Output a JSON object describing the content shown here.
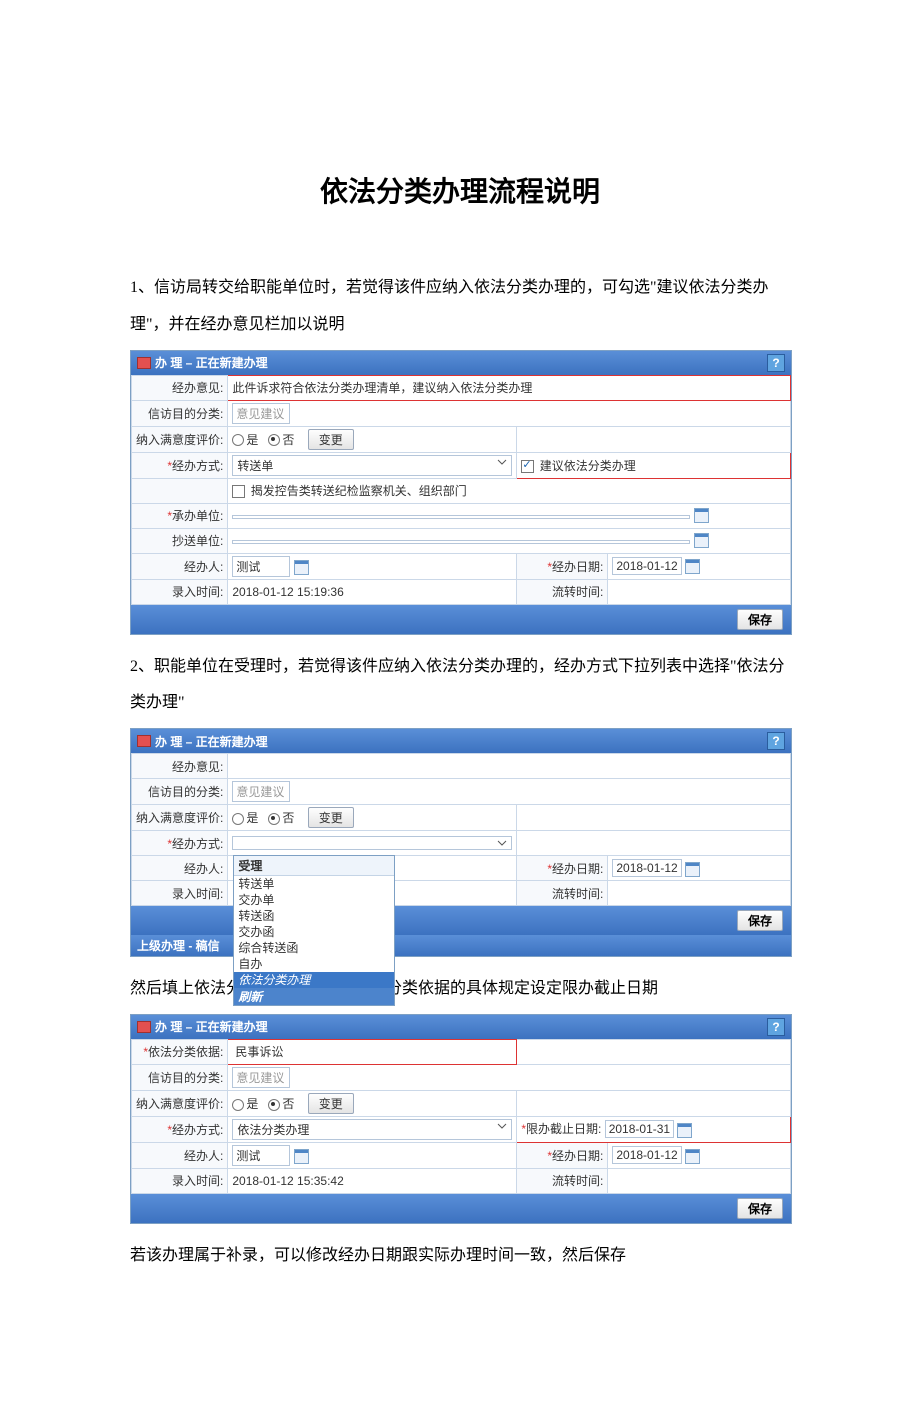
{
  "title": "依法分类办理流程说明",
  "para1": "1、信访局转交给职能单位时，若觉得该件应纳入依法分类办理的，可勾选\"建议依法分类办理\"，并在经办意见栏加以说明",
  "para2": "2、职能单位在受理时，若觉得该件应纳入依法分类办理的，经办方式下拉列表中选择\"依法分类办理\"",
  "para3": "然后填上依法分类依据，并根据依法分类依据的具体规定设定限办截止日期",
  "para4": "若该办理属于补录，可以修改经办日期跟实际办理时间一致，然后保存",
  "panel1": {
    "header": "办 理 – 正在新建办理",
    "help": "?",
    "fields": {
      "jbyj_label": "经办意见:",
      "jbyj_value": "此件诉求符合依法分类办理清单，建议纳入依法分类办理",
      "xfmdfl_label": "信访目的分类:",
      "xfmdfl_value": "意见建议",
      "nrmyd_label": "纳入满意度评价:",
      "nrmyd_yes": "是",
      "nrmyd_no": "否",
      "biange": "变更",
      "jbfs_label": "经办方式:",
      "jbfs_value": "转送单",
      "jyyffl_label": "建议依法分类办理",
      "jfkg_label": "揭发控告类转送纪检监察机关、组织部门",
      "cbdw_label": "承办单位:",
      "csdw_label": "抄送单位:",
      "jbr_label": "经办人:",
      "jbr_value": "测试",
      "jbrq_label": "经办日期:",
      "jbrq_value": "2018-01-12",
      "lrsj_label": "录入时间:",
      "lrsj_value": "2018-01-12 15:19:36",
      "lzsj_label": "流转时间:",
      "save": "保存"
    }
  },
  "panel2": {
    "header": "办 理 – 正在新建办理",
    "help": "?",
    "fields": {
      "jbyj_label": "经办意见:",
      "xfmdfl_label": "信访目的分类:",
      "xfmdfl_value": "意见建议",
      "nrmyd_label": "纳入满意度评价:",
      "nrmyd_yes": "是",
      "nrmyd_no": "否",
      "biange": "变更",
      "jbfs_label": "经办方式:",
      "jbr_label": "经办人:",
      "jbrq_label": "经办日期:",
      "jbrq_value": "2018-01-12",
      "lrsj_label": "录入时间:",
      "lzsj_label": "流转时间:",
      "save": "保存",
      "dd_header": "受理",
      "dd_items": [
        "转送单",
        "交办单",
        "转送函",
        "交办函",
        "综合转送函",
        "自办"
      ],
      "dd_highlight": "依法分类办理",
      "dd_footer": "刷新",
      "sub_head": "上级办理 - 稿信"
    }
  },
  "panel3": {
    "header": "办 理 – 正在新建办理",
    "help": "?",
    "fields": {
      "yfflyj_label": "依法分类依据:",
      "yfflyj_value": "民事诉讼",
      "xfmdfl_label": "信访目的分类:",
      "xfmdfl_value": "意见建议",
      "nrmyd_label": "纳入满意度评价:",
      "nrmyd_yes": "是",
      "nrmyd_no": "否",
      "biange": "变更",
      "jbfs_label": "经办方式:",
      "jbfs_value": "依法分类办理",
      "xbjz_label": "限办截止日期:",
      "xbjz_value": "2018-01-31",
      "jbr_label": "经办人:",
      "jbr_value": "测试",
      "jbrq_label": "经办日期:",
      "jbrq_value": "2018-01-12",
      "lrsj_label": "录入时间:",
      "lrsj_value": "2018-01-12 15:35:42",
      "lzsj_label": "流转时间:",
      "save": "保存"
    }
  }
}
